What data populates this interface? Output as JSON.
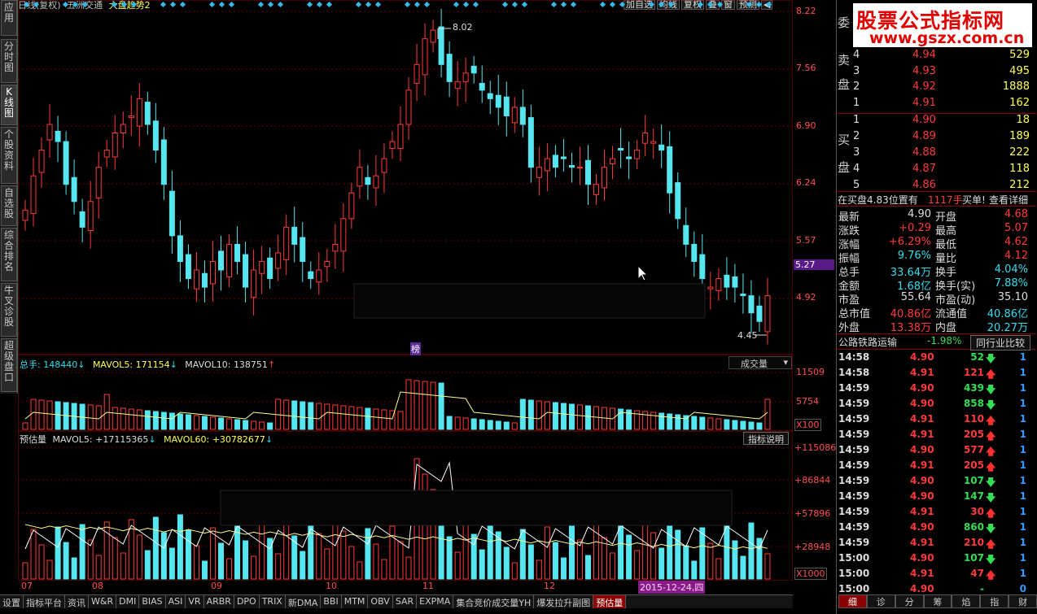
{
  "left_tabs": [
    "应用",
    "分时图",
    "K线图",
    "个股资料",
    "自选股",
    "综合排名",
    "牛叉诊股",
    "超级盘口"
  ],
  "topbar": {
    "period": "日线(复权)",
    "stock": "五洲交通",
    "indicator": "大盘趋势2"
  },
  "top_buttons": [
    "加自选",
    "均线",
    "复权",
    "叠",
    "窗",
    "预测"
  ],
  "price_labels": [
    "8.22",
    "7.56",
    "6.90",
    "6.24",
    "5.57",
    "5.27",
    "4.92"
  ],
  "max_label": "8.02",
  "min_label": "4.45",
  "bang": "榜",
  "vol_header": {
    "total_label": "总手:",
    "total": "148440",
    "ma5_label": "MAVOL5:",
    "ma5": "171154",
    "ma10_label": "MAVOL10:",
    "ma10": "138751",
    "dropdown": "成交量"
  },
  "vol_labels": [
    "11509",
    "5754",
    "X100"
  ],
  "est_header": {
    "name": "预估量",
    "ma5_label": "MAVOL5:",
    "ma5": "+17115365",
    "ma60_label": "MAVOL60:",
    "ma60": "+30782677",
    "help": "指标说明"
  },
  "est_labels": [
    "+115086",
    "+86844",
    "+57896",
    "+28948",
    "X1000"
  ],
  "dates": [
    "07",
    "08",
    "09",
    "10",
    "11",
    "12"
  ],
  "cur_date": "2015-12-24,四",
  "bottom_tabs": [
    "设置",
    "指标平台",
    "资讯",
    "W&R",
    "DMI",
    "BIAS",
    "ASI",
    "VR",
    "ARBR",
    "DPO",
    "TRIX",
    "新DMA",
    "BBI",
    "MTM",
    "OBV",
    "SAR",
    "EXPMA",
    "集合竞价成交量YH",
    "爆发拉升副图",
    "预估量"
  ],
  "logo": {
    "line1": "股票公式指标网",
    "line2": "www.gszx.com.cn"
  },
  "orderbook": {
    "wei": "委",
    "sell_label": [
      "卖",
      "盘"
    ],
    "buy_label": [
      "买",
      "盘"
    ],
    "sells": [
      {
        "n": "4",
        "p": "4.94",
        "v": "529"
      },
      {
        "n": "3",
        "p": "4.93",
        "v": "495"
      },
      {
        "n": "2",
        "p": "4.92",
        "v": "1888"
      },
      {
        "n": "1",
        "p": "4.91",
        "v": "162"
      }
    ],
    "buys": [
      {
        "n": "1",
        "p": "4.90",
        "v": "18"
      },
      {
        "n": "2",
        "p": "4.89",
        "v": "189"
      },
      {
        "n": "3",
        "p": "4.88",
        "v": "222"
      },
      {
        "n": "4",
        "p": "4.87",
        "v": "118"
      },
      {
        "n": "5",
        "p": "4.86",
        "v": "212"
      }
    ]
  },
  "notice": {
    "text": "在买盘4.83位置有",
    "qty": "1117手",
    "act": "买单!",
    "link": "查看详细"
  },
  "stats": [
    {
      "l1": "最新",
      "v1": "4.90",
      "l2": "开盘",
      "v2": "4.68"
    },
    {
      "l1": "涨跌",
      "v1": "+0.29",
      "l2": "最高",
      "v2": "5.07"
    },
    {
      "l1": "涨幅",
      "v1": "+6.29%",
      "l2": "最低",
      "v2": "4.62"
    },
    {
      "l1": "振幅",
      "v1": "9.76%",
      "l2": "量比",
      "v2": "4.12"
    },
    {
      "l1": "总手",
      "v1": "33.64万",
      "l2": "换手",
      "v2": "4.04%"
    },
    {
      "l1": "金额",
      "v1": "1.68亿",
      "l2": "换手(实)",
      "v2": "7.88%"
    },
    {
      "l1": "市盈",
      "v1": "55.64",
      "l2": "市盈(动)",
      "v2": "35.10"
    },
    {
      "l1": "总市值",
      "v1": "40.86亿",
      "l2": "流通值",
      "v2": "40.86亿"
    },
    {
      "l1": "外盘",
      "v1": "13.38万",
      "l2": "内盘",
      "v2": "20.27万"
    }
  ],
  "sector": {
    "name": "公路铁路运输",
    "pct": "-1.98%",
    "btn": "同行业比较"
  },
  "ticks": [
    {
      "t": "14:58",
      "p": "4.90",
      "v": "52",
      "d": "down",
      "c": "1"
    },
    {
      "t": "14:58",
      "p": "4.91",
      "v": "121",
      "d": "up",
      "c": "1"
    },
    {
      "t": "14:59",
      "p": "4.90",
      "v": "439",
      "d": "down",
      "c": "1"
    },
    {
      "t": "14:59",
      "p": "4.90",
      "v": "858",
      "d": "down",
      "c": "1"
    },
    {
      "t": "14:59",
      "p": "4.91",
      "v": "110",
      "d": "up",
      "c": "1"
    },
    {
      "t": "14:59",
      "p": "4.91",
      "v": "205",
      "d": "up",
      "c": "1"
    },
    {
      "t": "14:59",
      "p": "4.90",
      "v": "577",
      "d": "up",
      "c": "1"
    },
    {
      "t": "14:59",
      "p": "4.91",
      "v": "205",
      "d": "up",
      "c": "1"
    },
    {
      "t": "14:59",
      "p": "4.90",
      "v": "107",
      "d": "down",
      "c": "1"
    },
    {
      "t": "14:59",
      "p": "4.90",
      "v": "147",
      "d": "down",
      "c": "1"
    },
    {
      "t": "14:59",
      "p": "4.91",
      "v": "30",
      "d": "up",
      "c": "1"
    },
    {
      "t": "14:59",
      "p": "4.90",
      "v": "860",
      "d": "down",
      "c": "1"
    },
    {
      "t": "14:59",
      "p": "4.91",
      "v": "210",
      "d": "up",
      "c": "1"
    },
    {
      "t": "15:00",
      "p": "4.90",
      "v": "107",
      "d": "down",
      "c": "1"
    },
    {
      "t": "15:00",
      "p": "4.91",
      "v": "47",
      "d": "up",
      "c": "1"
    },
    {
      "t": "15:00",
      "p": "4.90",
      "v": "-",
      "d": "none",
      "c": "0"
    }
  ],
  "right_tabs": [
    "细",
    "诊",
    "分",
    "筹",
    "焰",
    "指",
    "财"
  ]
}
